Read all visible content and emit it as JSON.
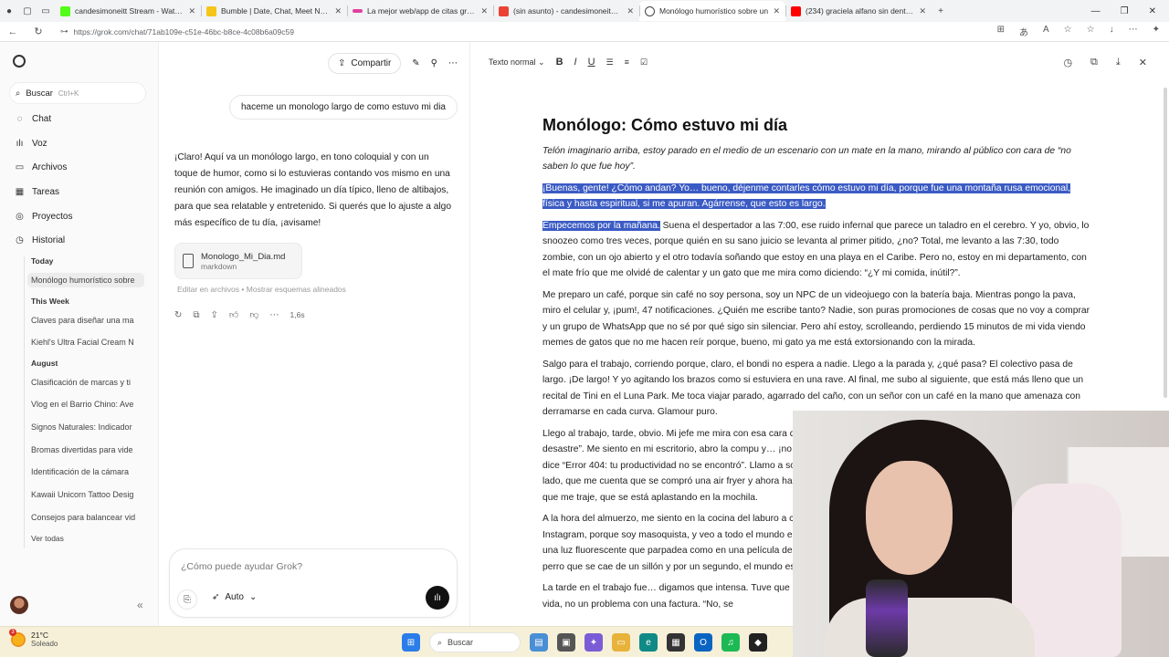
{
  "browser": {
    "tabs": [
      {
        "title": "candesimoneitt Stream - Watch L",
        "color": "#53fc18"
      },
      {
        "title": "Bumble | Date, Chat, Meet New P",
        "color": "#f5c518"
      },
      {
        "title": "La mejor web/app de citas gratis",
        "color": "#e040a0"
      },
      {
        "title": "(sin asunto) - candesimoneit@gn",
        "color": "#ea4335"
      },
      {
        "title": "Monólogo humorístico sobre un",
        "color": "#444444"
      },
      {
        "title": "(234) graciela alfano sin dentadu",
        "color": "#ff0000"
      }
    ],
    "url": "https://grok.com/chat/71ab109e-c51e-46bc-b8ce-4c08b6a09c59"
  },
  "sidebar": {
    "search_label": "Buscar",
    "search_shortcut": "Ctrl+K",
    "nav": [
      {
        "label": "Chat",
        "icon": "chat-icon"
      },
      {
        "label": "Voz",
        "icon": "voice-wave-icon"
      },
      {
        "label": "Archivos",
        "icon": "folder-icon"
      },
      {
        "label": "Tareas",
        "icon": "tasks-icon"
      },
      {
        "label": "Proyectos",
        "icon": "projects-icon"
      },
      {
        "label": "Historial",
        "icon": "history-icon"
      }
    ],
    "history": {
      "today_label": "Today",
      "today": [
        "Monólogo humorístico sobre"
      ],
      "week_label": "This Week",
      "week": [
        "Claves para diseñar una ma",
        "Kiehl's Ultra Facial Cream N"
      ],
      "august_label": "August",
      "august": [
        "Clasificación de marcas y ti",
        "Vlog en el Barrio Chino: Ave",
        "Signos Naturales: Indicador",
        "Bromas divertidas para vide",
        "Identificación de la cámara",
        "Kawaii Unicorn Tattoo Desig",
        "Consejos para balancear vid"
      ],
      "see_all": "Ver todas"
    }
  },
  "chat": {
    "share_label": "Compartir",
    "user_message": "haceme un monologo largo de como estuvo mi dia",
    "assistant_reply": "¡Claro! Aquí va un monólogo largo, en tono coloquial y con un toque de humor, como si lo estuvieras contando vos mismo en una reunión con amigos. He imaginado un día típico, lleno de altibajos, para que sea relatable y entretenido. Si querés que lo ajuste a algo más específico de tu día, ¡avisame!",
    "file_name": "Monologo_Mi_Dia.md",
    "file_type": "markdown",
    "edit_link": "Editar en archivos",
    "diff_link": "Mostrar esquemas alineados",
    "response_time": "1,6s",
    "composer_placeholder": "¿Cómo puede ayudar Grok?",
    "mode_label": "Auto"
  },
  "document": {
    "style_label": "Texto normal",
    "title": "Monólogo: Cómo estuvo mi día",
    "intro": "Telón imaginario arriba, estoy parado en el medio de un escenario con un mate en la mano, mirando al público con cara de “no saben lo que fue hoy”.",
    "p1_highlight": "¡Buenas, gente! ¿Cómo andan? Yo… bueno, déjenme contarles cómo estuvo mi día, porque fue una montaña rusa emocional, física y hasta espiritual, si me apuran. Agárrense, que esto es largo.",
    "p2_highlight": "Empecemos por la mañana.",
    "p2_rest": " Suena el despertador a las 7:00, ese ruido infernal que parece un taladro en el cerebro. Y yo, obvio, lo snoozeo como tres veces, porque quién en su sano juicio se levanta al primer pitido, ¿no? Total, me levanto a las 7:30, todo zombie, con un ojo abierto y el otro todavía soñando que estoy en una playa en el Caribe. Pero no, estoy en mi departamento, con el mate frío que me olvidé de calentar y un gato que me mira como diciendo: “¿Y mi comida, inútil?”.",
    "p3": "Me preparo un café, porque sin café no soy persona, soy un NPC de un videojuego con la batería baja. Mientras pongo la pava, miro el celular y, ¡pum!, 47 notificaciones. ¿Quién me escribe tanto? Nadie, son puras promociones de cosas que no voy a comprar y un grupo de WhatsApp que no sé por qué sigo sin silenciar. Pero ahí estoy, scrolleando, perdiendo 15 minutos de mi vida viendo memes de gatos que no me hacen reír porque, bueno, mi gato ya me está extorsionando con la mirada.",
    "p4": "Salgo para el trabajo, corriendo porque, claro, el bondi no espera a nadie. Llego a la parada y, ¿qué pasa? El colectivo pasa de largo. ¡De largo! Y yo agitando los brazos como si estuviera en una rave. Al final, me subo al siguiente, que está más lleno que un recital de Tini en el Luna Park. Me toca viajar parado, agarrado del caño, con un señor con un café en la mano que amenaza con derramarse en cada curva. Glamour puro.",
    "p5": "Llego al trabajo, tarde, obvio. Mi jefe me mira con esa cara de “otra vez vos”, y yo le pongo mi mejor sonrisa de “perdón, el desastre”. Me siento en mi escritorio, abro la compu y… ¡no anda! La pantalla se queda negra y después aparece una pantalla que dice “Error 404: tu productividad no se encontró”. Llamo a soporte, y me atiende un pibe que se la pasa hablando de cualquier lado, que me cuenta que se compró una air fryer y ahora hace todo ahí. Yo mientras tanto pensando en el sánguche de milanesa que me traje, que se está aplastando en la mochila.",
    "p6": "A la hora del almuerzo, me siento en la cocina del laburo a comer mi sánguche, que para esa altura parece una tortilla. Abro Instagram, porque soy masoquista, y veo a todo el mundo en la playa, en Europa, comiendo sushi. Y yo acá, estoy comiendo bajo una luz fluorescente que parpadea como en una película de terror. Me consuelo mandándole a mi amiga un reel con un reel de un perro que se cae de un sillón y por un segundo, el mundo es un lugar mejor.",
    "p7": "La tarde en el trabajo fue… digamos que intensa. Tuve que ir a una reunión que podría haber sido un mail, donde se resuelva la vida, no un problema con una factura. “No, se"
  },
  "taskbar": {
    "temp": "21°C",
    "condition": "Soleado",
    "badge": "3",
    "search_label": "Buscar"
  }
}
